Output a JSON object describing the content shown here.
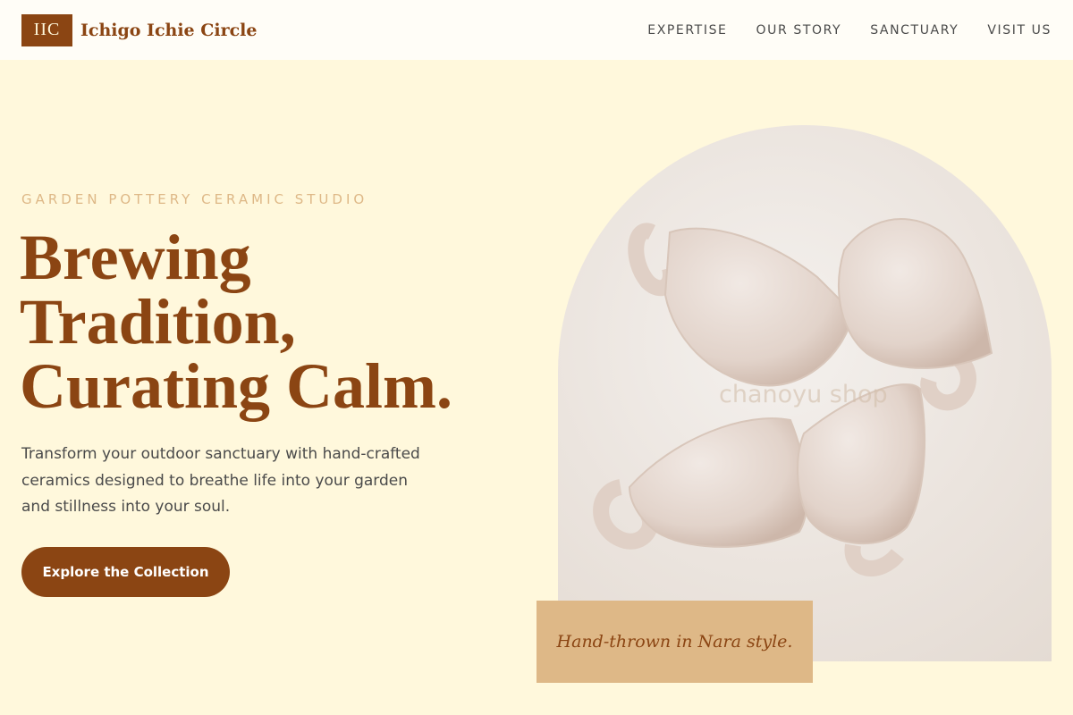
{
  "header": {
    "logo_text": "IIC",
    "brand_name": "Ichigo Ichie Circle",
    "nav": [
      "EXPERTISE",
      "OUR STORY",
      "SANCTUARY",
      "VISIT US"
    ]
  },
  "hero": {
    "eyebrow": "GARDEN POTTERY CERAMIC STUDIO",
    "headline": [
      "Brewing",
      "Tradition,",
      "Curating Calm."
    ],
    "lead": "Transform your outdoor sanctuary with hand-crafted ceramics designed to breathe life into your garden and stillness into your soul.",
    "cta_label": "Explore the Collection"
  },
  "image": {
    "description_icon": "ceramic-cups-photo",
    "watermark": "chanoyu shop"
  },
  "caption": "Hand-thrown in Nara style.",
  "colors": {
    "background": "#fff8dc",
    "header": "#fffdf7",
    "brand": "#8b4513",
    "accent": "#deb887",
    "text": "#4a4a4a"
  }
}
